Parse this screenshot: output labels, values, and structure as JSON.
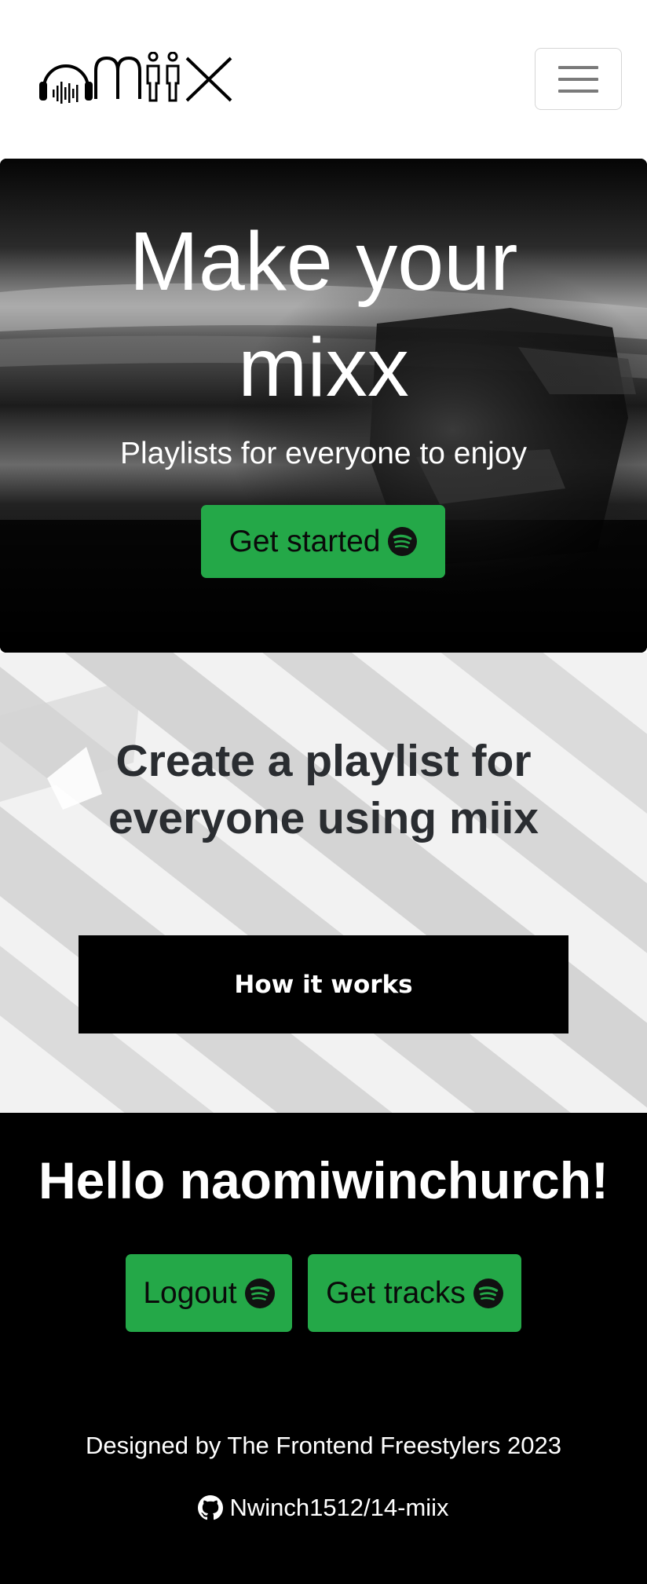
{
  "navbar": {
    "logo_text": "miix",
    "logo_icon": "headphones-waveform-icon",
    "menu_icon": "hamburger-menu-icon"
  },
  "hero": {
    "title_line1": "Make your",
    "title_line2": "mixx",
    "subtitle": "Playlists for everyone to enjoy",
    "cta_label": "Get started",
    "cta_icon": "spotify-icon"
  },
  "promo": {
    "title_line1": "Create a playlist for",
    "title_line2": "everyone using miix",
    "button_label": "How it works"
  },
  "user": {
    "greeting": "Hello naomiwinchurch!",
    "logout_label": "Logout",
    "get_tracks_label": "Get tracks"
  },
  "footer": {
    "credit": "Designed by The Frontend Freestylers 2023",
    "repo_icon": "github-icon",
    "repo_label": "Nwinch1512/14-miix"
  },
  "colors": {
    "accent_green": "#24a848",
    "hero_background": "#000000",
    "footer_background": "#000000"
  }
}
